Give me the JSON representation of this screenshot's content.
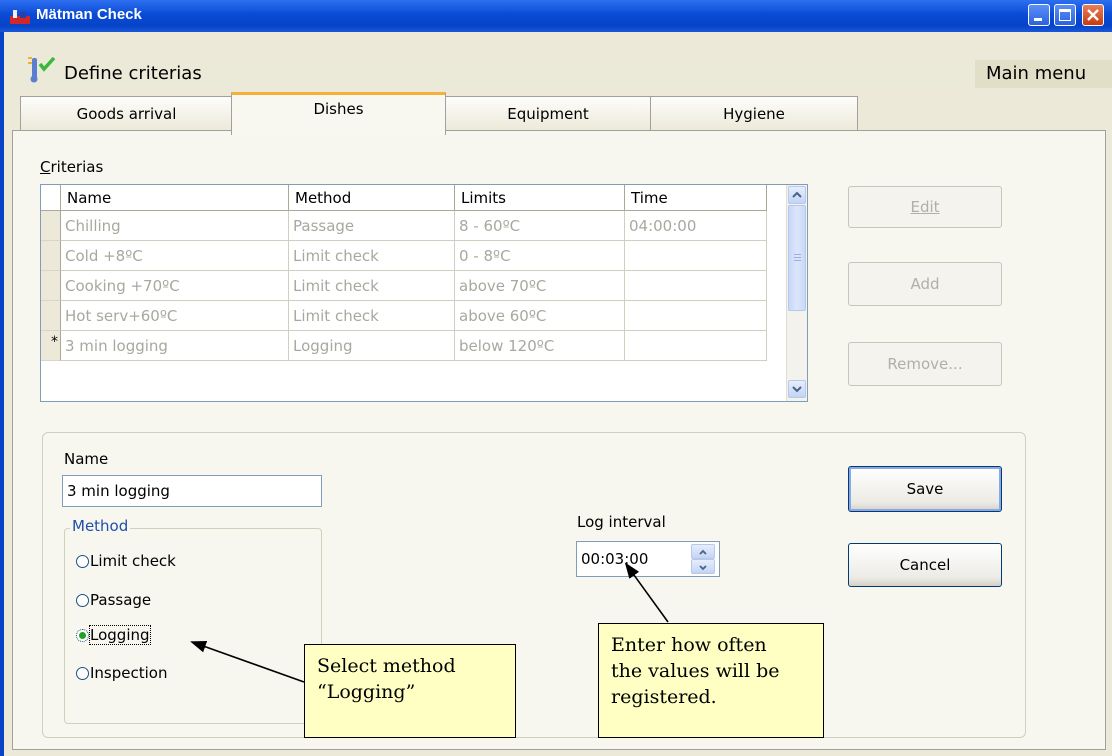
{
  "window": {
    "title": "Mätman Check"
  },
  "header": {
    "title": "Define criterias",
    "main_menu": "Main menu"
  },
  "tabs": [
    {
      "label": "Goods arrival",
      "active": false
    },
    {
      "label": "Dishes",
      "active": true
    },
    {
      "label": "Equipment",
      "active": false
    },
    {
      "label": "Hygiene",
      "active": false
    }
  ],
  "criterias": {
    "label": "Criterias",
    "columns": [
      "Name",
      "Method",
      "Limits",
      "Time"
    ],
    "rows": [
      {
        "marker": "",
        "name": "Chilling",
        "method": "Passage",
        "limits": "8 - 60ºC",
        "time": "04:00:00"
      },
      {
        "marker": "",
        "name": "Cold +8ºC",
        "method": "Limit check",
        "limits": "0 - 8ºC",
        "time": ""
      },
      {
        "marker": "",
        "name": "Cooking +70ºC",
        "method": "Limit check",
        "limits": "above 70ºC",
        "time": ""
      },
      {
        "marker": "",
        "name": "Hot serv+60ºC",
        "method": "Limit check",
        "limits": "above 60ºC",
        "time": ""
      },
      {
        "marker": "*",
        "name": "3 min logging",
        "method": "Logging",
        "limits": "below 120ºC",
        "time": ""
      }
    ]
  },
  "side_buttons": {
    "edit": "Edit",
    "add": "Add",
    "remove": "Remove..."
  },
  "form": {
    "name_label": "Name",
    "name_value": "3 min logging",
    "method_label": "Method",
    "methods": [
      "Limit check",
      "Passage",
      "Logging",
      "Inspection"
    ],
    "selected_method": "Logging",
    "log_interval_label": "Log interval",
    "log_interval_value": "00:03:00",
    "save": "Save",
    "cancel": "Cancel"
  },
  "callouts": {
    "method": [
      "Select method",
      "“Logging”"
    ],
    "interval": [
      "Enter how often",
      "the values will be",
      "registered."
    ]
  },
  "colors": {
    "titlebar": "#0a4bd6",
    "active_tab_accent": "#f6b03c",
    "callout_bg": "#ffffc4",
    "radio_dot": "#21a121"
  }
}
